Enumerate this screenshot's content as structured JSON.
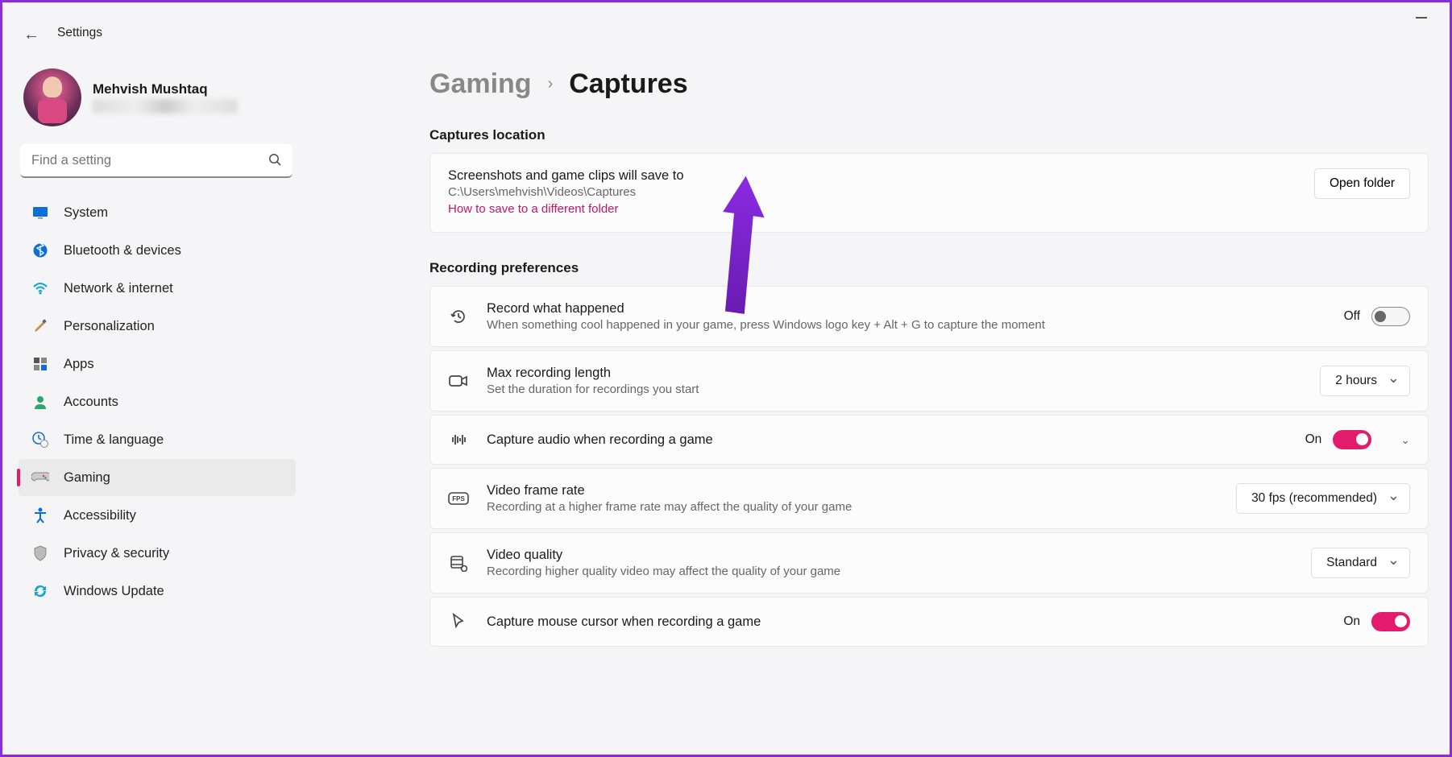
{
  "window": {
    "title": "Settings"
  },
  "profile": {
    "name": "Mehvish Mushtaq"
  },
  "search": {
    "placeholder": "Find a setting"
  },
  "nav": {
    "items": [
      {
        "label": "System"
      },
      {
        "label": "Bluetooth & devices"
      },
      {
        "label": "Network & internet"
      },
      {
        "label": "Personalization"
      },
      {
        "label": "Apps"
      },
      {
        "label": "Accounts"
      },
      {
        "label": "Time & language"
      },
      {
        "label": "Gaming"
      },
      {
        "label": "Accessibility"
      },
      {
        "label": "Privacy & security"
      },
      {
        "label": "Windows Update"
      }
    ]
  },
  "breadcrumb": {
    "parent": "Gaming",
    "current": "Captures"
  },
  "sections": {
    "location": {
      "title": "Captures location",
      "card_title": "Screenshots and game clips will save to",
      "path": "C:\\Users\\mehvish\\Videos\\Captures",
      "link": "How to save to a different folder",
      "button": "Open folder"
    },
    "prefs": {
      "title": "Recording preferences",
      "record": {
        "title": "Record what happened",
        "sub": "When something cool happened in your game, press Windows logo key + Alt + G to capture the moment",
        "state": "Off"
      },
      "maxlen": {
        "title": "Max recording length",
        "sub": "Set the duration for recordings you start",
        "value": "2 hours"
      },
      "audio": {
        "title": "Capture audio when recording a game",
        "state": "On"
      },
      "frate": {
        "title": "Video frame rate",
        "sub": "Recording at a higher frame rate may affect the quality of your game",
        "value": "30 fps (recommended)"
      },
      "quality": {
        "title": "Video quality",
        "sub": "Recording higher quality video may affect the quality of your game",
        "value": "Standard"
      },
      "cursor": {
        "title": "Capture mouse cursor when recording a game",
        "state": "On"
      }
    }
  }
}
